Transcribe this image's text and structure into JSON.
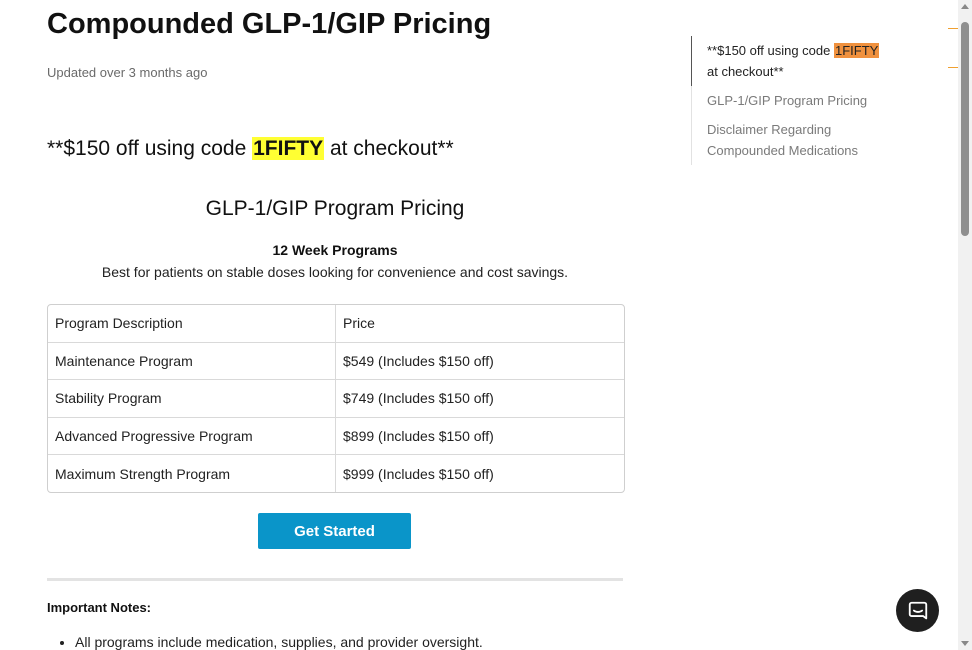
{
  "article": {
    "title": "Compounded GLP-1/GIP Pricing",
    "updated": "Updated over 3 months ago",
    "promo": {
      "prefix": "**$150 off using code ",
      "code": "1FIFTY",
      "suffix": " at checkout**"
    },
    "section_title": "GLP-1/GIP Program Pricing",
    "programs_heading": "12 Week Programs",
    "programs_description": "Best for patients on stable doses looking for convenience and cost savings.",
    "table": {
      "headers": [
        "Program Description",
        "Price"
      ],
      "rows": [
        [
          "Maintenance Program",
          "$549 (Includes $150 off)"
        ],
        [
          "Stability Program",
          "$749 (Includes $150 off)"
        ],
        [
          "Advanced Progressive Program",
          "$899 (Includes $150 off)"
        ],
        [
          "Maximum Strength Program",
          "$999 (Includes $150 off)"
        ]
      ]
    },
    "cta_label": "Get Started",
    "notes_heading": "Important Notes:",
    "notes": [
      "All programs include medication, supplies, and provider oversight."
    ]
  },
  "toc": {
    "items": [
      {
        "prefix": "**$150 off using code ",
        "code": "1FIFTY",
        "suffix": " at checkout**",
        "active": true
      },
      {
        "label": "GLP-1/GIP Program Pricing"
      },
      {
        "label": "Disclaimer Regarding Compounded Medications"
      }
    ]
  },
  "colors": {
    "code_highlight": "#ffff33",
    "toc_highlight": "#f0913e",
    "cta_background": "#0a95c9",
    "chat_launcher": "#1f1f1f"
  },
  "icons": {
    "chat_launcher": "chat-bubble-icon"
  }
}
